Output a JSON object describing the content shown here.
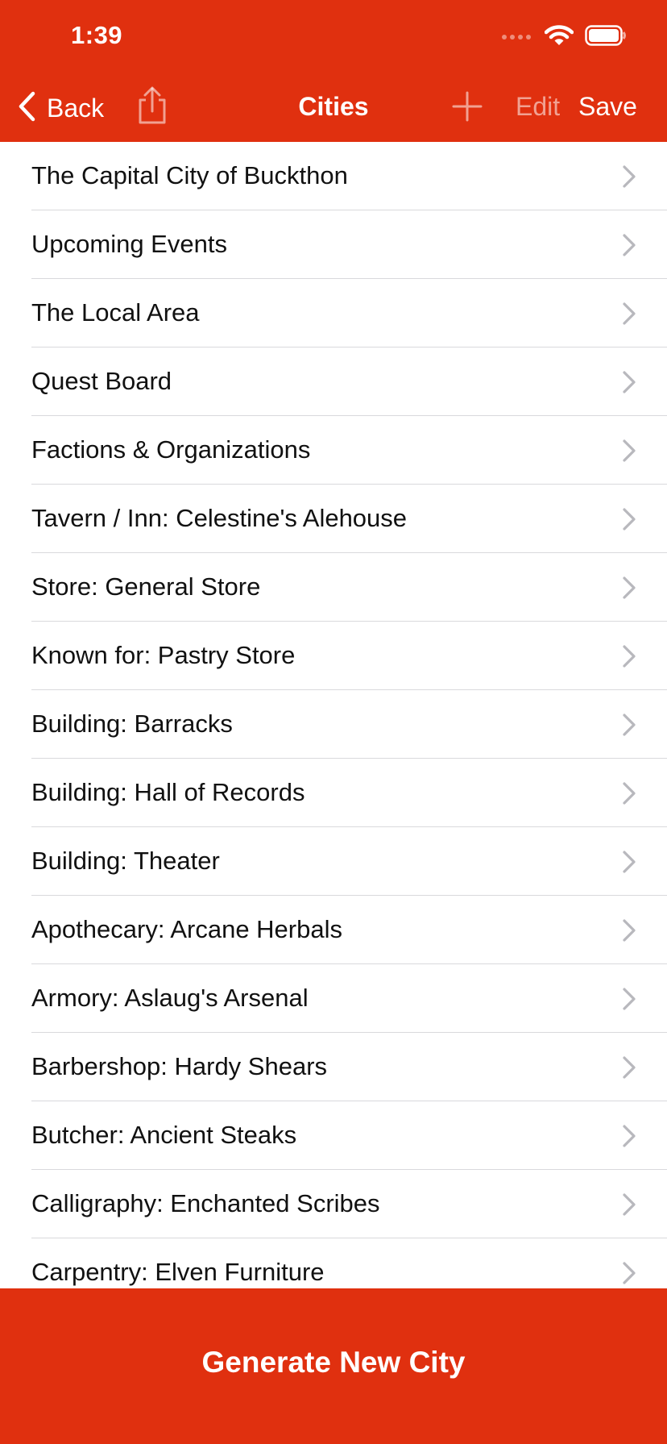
{
  "status_bar": {
    "time": "1:39",
    "signal_icon": "signal-dots-icon",
    "wifi_icon": "wifi-icon",
    "battery_icon": "battery-icon"
  },
  "nav": {
    "back_label": "Back",
    "title": "Cities",
    "edit_label": "Edit",
    "save_label": "Save",
    "share_icon": "share-icon",
    "add_icon": "plus-icon"
  },
  "colors": {
    "accent": "#e0300f",
    "text": "#111111",
    "separator": "#d9d9dc",
    "chevron": "#b8b8bd"
  },
  "list": {
    "items": [
      {
        "label": "The Capital City of Buckthon"
      },
      {
        "label": "Upcoming Events"
      },
      {
        "label": "The Local Area"
      },
      {
        "label": "Quest Board"
      },
      {
        "label": "Factions & Organizations"
      },
      {
        "label": "Tavern / Inn: Celestine's Alehouse"
      },
      {
        "label": "Store: General Store"
      },
      {
        "label": "Known for: Pastry Store"
      },
      {
        "label": "Building: Barracks"
      },
      {
        "label": "Building: Hall of Records"
      },
      {
        "label": "Building: Theater"
      },
      {
        "label": "Apothecary: Arcane Herbals"
      },
      {
        "label": "Armory: Aslaug's Arsenal"
      },
      {
        "label": "Barbershop: Hardy Shears"
      },
      {
        "label": "Butcher: Ancient Steaks"
      },
      {
        "label": "Calligraphy: Enchanted Scribes"
      },
      {
        "label": "Carpentry: Elven Furniture"
      }
    ]
  },
  "footer": {
    "generate_label": "Generate New City"
  }
}
